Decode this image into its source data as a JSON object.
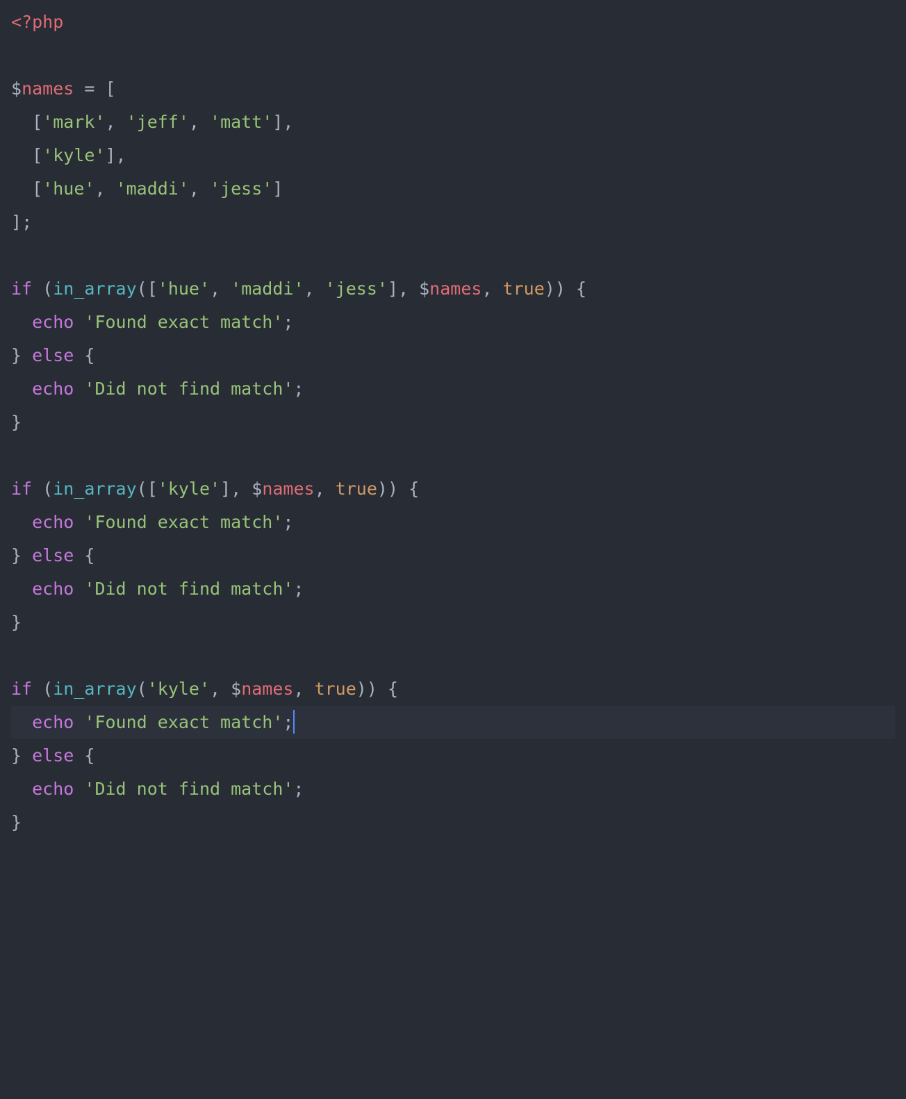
{
  "language": "php",
  "colors": {
    "background": "#282c34",
    "foreground": "#abb2bf",
    "gutterHighlight": "#2c313c",
    "cursor": "#528bff",
    "red": "#e06c75",
    "purple": "#c678dd",
    "cyan": "#56b6c2",
    "blueFunc": "#61afef",
    "green": "#98c379",
    "orange": "#d19a66"
  },
  "cursor": {
    "line": 22,
    "afterText": "  echo 'Found exact match';"
  },
  "highlightedLine": 22,
  "sourceLines": [
    "<?php",
    "",
    "$names = [",
    "  ['mark', 'jeff', 'matt'],",
    "  ['kyle'],",
    "  ['hue', 'maddi', 'jess']",
    "];",
    "",
    "if (in_array(['hue', 'maddi', 'jess'], $names, true)) {",
    "  echo 'Found exact match';",
    "} else {",
    "  echo 'Did not find match';",
    "}",
    "",
    "if (in_array(['kyle'], $names, true)) {",
    "  echo 'Found exact match';",
    "} else {",
    "  echo 'Did not find match';",
    "}",
    "",
    "if (in_array('kyle', $names, true)) {",
    "  echo 'Found exact match';",
    "} else {",
    "  echo 'Did not find match';",
    "}"
  ],
  "tokens": {
    "phpOpen": "<?php",
    "dollar": "$",
    "var_names": "names",
    "eq": " = ",
    "lbrack": "[",
    "rbrack": "]",
    "comma": ", ",
    "commaTrail": ",",
    "semi": ";",
    "indent": "  ",
    "lparen": "(",
    "rparen": ")",
    "space": " ",
    "kw_if": "if",
    "kw_else": "else",
    "kw_echo": "echo",
    "kw_true": "true",
    "fn_in_array": "in_array",
    "lbrace": "{",
    "rbrace": "}",
    "str_mark": "'mark'",
    "str_jeff": "'jeff'",
    "str_matt": "'matt'",
    "str_kyle": "'kyle'",
    "str_hue": "'hue'",
    "str_maddi": "'maddi'",
    "str_jess": "'jess'",
    "str_found": "'Found exact match'",
    "str_notfound": "'Did not find match'"
  }
}
